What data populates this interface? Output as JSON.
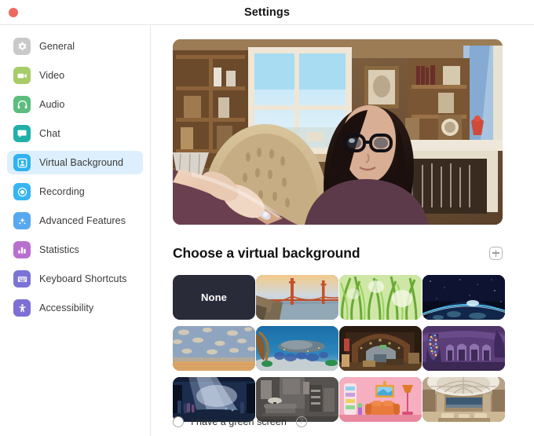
{
  "window": {
    "title": "Settings",
    "close_button": "close-button"
  },
  "sidebar": {
    "items": [
      {
        "label": "General",
        "icon": "gear-icon",
        "color": "#c9c9c9",
        "active": false
      },
      {
        "label": "Video",
        "icon": "video-camera-icon",
        "color": "#a8cc68",
        "active": false
      },
      {
        "label": "Audio",
        "icon": "headphones-icon",
        "color": "#5cbd7e",
        "active": false
      },
      {
        "label": "Chat",
        "icon": "chat-bubble-icon",
        "color": "#21b0a8",
        "active": false
      },
      {
        "label": "Virtual Background",
        "icon": "person-frame-icon",
        "color": "#2fb3f0",
        "active": true
      },
      {
        "label": "Recording",
        "icon": "record-circle-icon",
        "color": "#36b5f2",
        "active": false
      },
      {
        "label": "Advanced Features",
        "icon": "sparkle-icon",
        "color": "#56a9f0",
        "active": false
      },
      {
        "label": "Statistics",
        "icon": "bar-chart-icon",
        "color": "#b96fcf",
        "active": false
      },
      {
        "label": "Keyboard Shortcuts",
        "icon": "keyboard-icon",
        "color": "#7b74d6",
        "active": false
      },
      {
        "label": "Accessibility",
        "icon": "accessibility-icon",
        "color": "#7d6fd4",
        "active": false
      }
    ],
    "active_highlight_color": "#ddeffc"
  },
  "main": {
    "preview": {
      "name": "video-preview",
      "description": "Woman with glasses seated in a cozy living room with fireplace, bookshelves and a bright window"
    },
    "section_title": "Choose a virtual background",
    "add_button_label": "+",
    "backgrounds": [
      {
        "id": "none",
        "label": "None",
        "type": "none"
      },
      {
        "id": "bridge",
        "label": "",
        "type": "golden-gate-bridge-sunset"
      },
      {
        "id": "grass",
        "label": "",
        "type": "green-grass-closeup"
      },
      {
        "id": "earth",
        "label": "",
        "type": "earth-from-space"
      },
      {
        "id": "clouds",
        "label": "",
        "type": "cloud-wallpaper-room"
      },
      {
        "id": "reef",
        "label": "",
        "type": "underwater-coral-reef"
      },
      {
        "id": "barn",
        "label": "",
        "type": "rustic-wooden-barn-interior"
      },
      {
        "id": "purple-hall",
        "label": "",
        "type": "purple-animated-hall"
      },
      {
        "id": "light-rays",
        "label": "",
        "type": "blue-cavern-light-rays"
      },
      {
        "id": "livingroom",
        "label": "",
        "type": "modern-grey-living-room"
      },
      {
        "id": "pink-room",
        "label": "",
        "type": "pink-cartoon-living-room"
      },
      {
        "id": "lobby",
        "label": "",
        "type": "hotel-lobby-domed-ceiling"
      }
    ],
    "green_screen": {
      "label": "I have a green screen",
      "checked": false,
      "help_glyph": "?"
    }
  }
}
